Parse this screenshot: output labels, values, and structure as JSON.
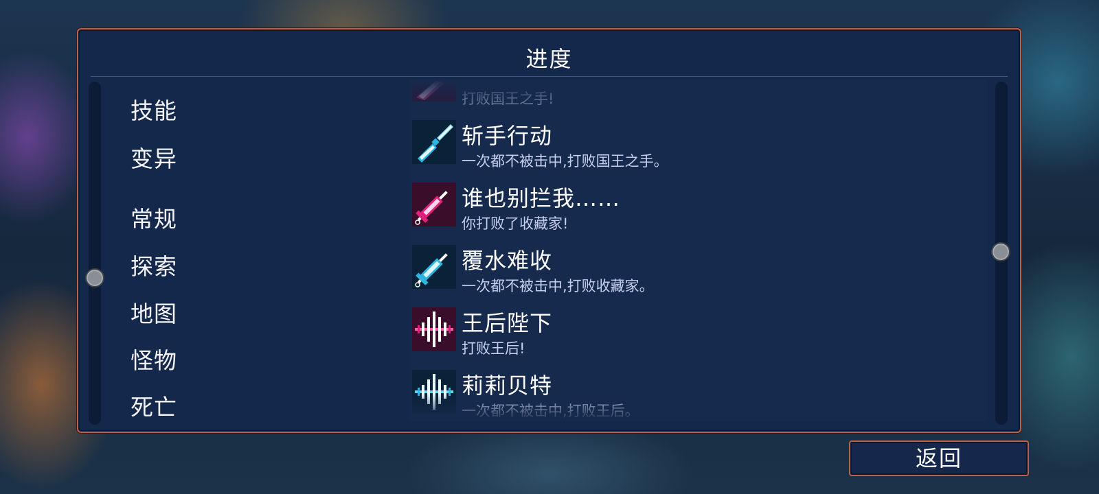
{
  "panel": {
    "title": "进度"
  },
  "categories": [
    {
      "label": "技能",
      "icon": "category-skills"
    },
    {
      "label": "变异",
      "icon": "category-mutations"
    },
    {
      "label": "常规",
      "icon": "category-general"
    },
    {
      "label": "探索",
      "icon": "category-exploration"
    },
    {
      "label": "地图",
      "icon": "category-map"
    },
    {
      "label": "怪物",
      "icon": "category-monsters"
    },
    {
      "label": "死亡",
      "icon": "category-death"
    }
  ],
  "achievements": [
    {
      "title": "",
      "desc": "打败国王之手!",
      "icon": "magenta-blade-icon"
    },
    {
      "title": "斩手行动",
      "desc": "一次都不被击中,打败国王之手。",
      "icon": "cyan-blade-icon"
    },
    {
      "title": "谁也别拦我……",
      "desc": "你打败了收藏家!",
      "icon": "magenta-syringe-icon"
    },
    {
      "title": "覆水难收",
      "desc": "一次都不被击中,打败收藏家。",
      "icon": "cyan-syringe-icon"
    },
    {
      "title": "王后陛下",
      "desc": "打败王后!",
      "icon": "magenta-soundwave-icon"
    },
    {
      "title": "莉莉贝特",
      "desc": "一次都不被击中,打败王后。",
      "icon": "cyan-soundwave-icon"
    }
  ],
  "footer": {
    "back_label": "返回"
  },
  "colors": {
    "border": "#b9624c",
    "panel": "#13284a",
    "magenta": "#e0207a",
    "cyan": "#2fb6e0"
  }
}
